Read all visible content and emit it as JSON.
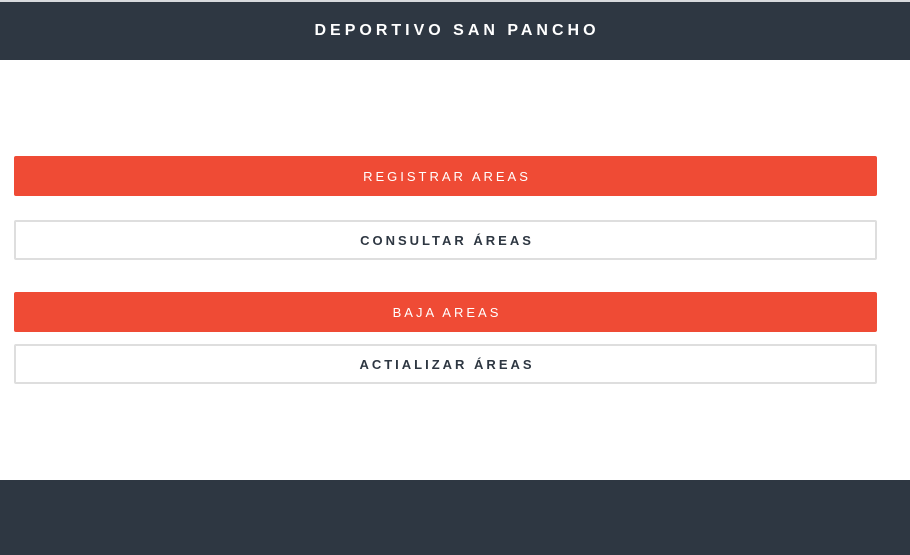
{
  "header": {
    "title": "DEPORTIVO SAN PANCHO"
  },
  "menu": {
    "registrar": "REGISTRAR AREAS",
    "consultar": "CONSULTAR ÁREAS",
    "baja": "BAJA AREAS",
    "actualizar": "ACTIALIZAR ÁREAS"
  },
  "colors": {
    "header_bg": "#2e3742",
    "accent": "#ef4b35",
    "outline_border": "#dedede"
  }
}
